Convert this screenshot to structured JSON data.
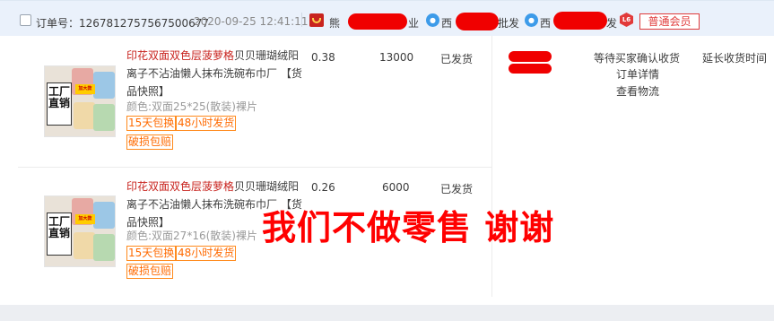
{
  "header": {
    "order_label": "订单号：1267812757567500677",
    "order_time": "2020-09-25 12:41:11",
    "seller_prefix": "熊",
    "seller_suffix": "业",
    "buyer1_prefix": "西",
    "buyer1_suffix": "批发",
    "buyer2_prefix": "西",
    "buyer2_suffix": "发",
    "level_badge": "L6",
    "member_tag": "普通会员",
    "icons": [
      "checkbox-icon",
      "shop-icon",
      "wangwang-icon",
      "level-badge-icon"
    ]
  },
  "items": [
    {
      "title_highlight": "印花双面双色层菠萝格",
      "title_rest": "贝贝珊瑚绒阳离子不沾油懒人抹布洗碗布巾厂",
      "snapshot": "【货品快照】",
      "spec": "颜色:双面25*25(散装)裸片",
      "tags": [
        "15天包换",
        "48小时发货",
        "破损包赔"
      ],
      "price": "0.38",
      "qty": "13000",
      "status": "已发货",
      "thumb_text": "工厂直销",
      "thumb_tag": "加大款"
    },
    {
      "title_highlight": "印花双面双色层菠萝格",
      "title_rest": "贝贝珊瑚绒阳离子不沾油懒人抹布洗碗布巾厂",
      "snapshot": "【货品快照】",
      "spec": "颜色:双面27*16(散装)裸片",
      "tags": [
        "15天包换",
        "48小时发货",
        "破损包赔"
      ],
      "price": "0.26",
      "qty": "6000",
      "status": "已发货",
      "thumb_text": "工厂直销",
      "thumb_tag": "加大款"
    }
  ],
  "order_status": {
    "state": "等待买家确认收货",
    "detail_link": "订单详情",
    "logistics_link": "查看物流",
    "extend_link": "延长收货时间"
  },
  "watermark": "我们不做零售 谢谢",
  "colors": {
    "accent_red": "#c8231e",
    "tag_orange": "#ff6a00",
    "header_bg": "#eaf1fb",
    "watermark_red": "#ff0000"
  }
}
